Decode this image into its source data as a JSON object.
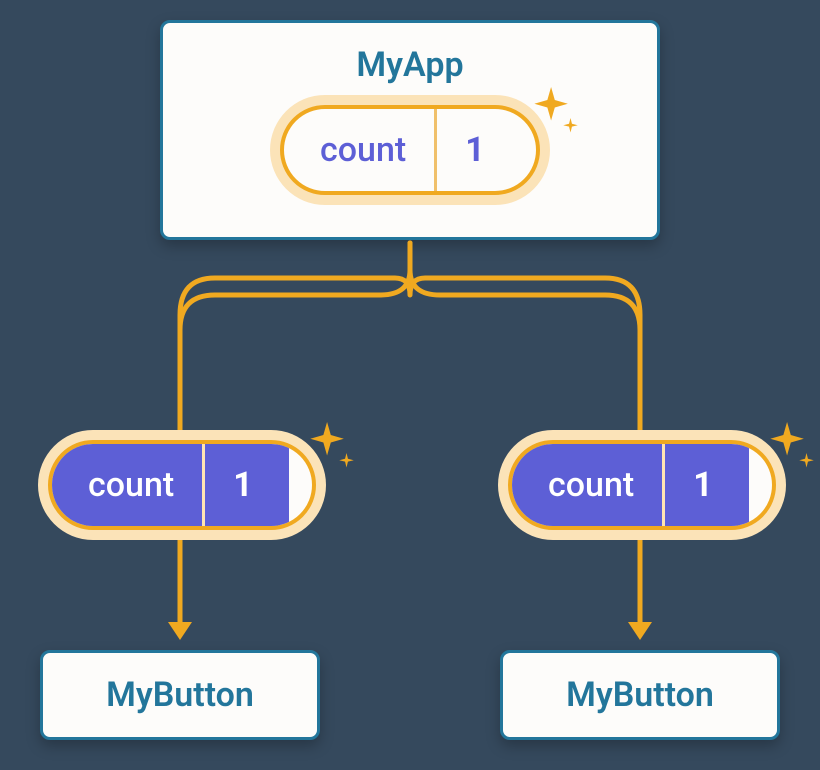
{
  "parent": {
    "title": "MyApp",
    "state": {
      "label": "count",
      "value": "1"
    }
  },
  "props": [
    {
      "label": "count",
      "value": "1"
    },
    {
      "label": "count",
      "value": "1"
    }
  ],
  "children": [
    {
      "label": "MyButton"
    },
    {
      "label": "MyButton"
    }
  ],
  "colors": {
    "bg": "#35495d",
    "card": "#fdfcfa",
    "border": "#23769b",
    "accent": "#f0a920",
    "glow": "#fbe3b8",
    "purple": "#5d5fd6"
  }
}
